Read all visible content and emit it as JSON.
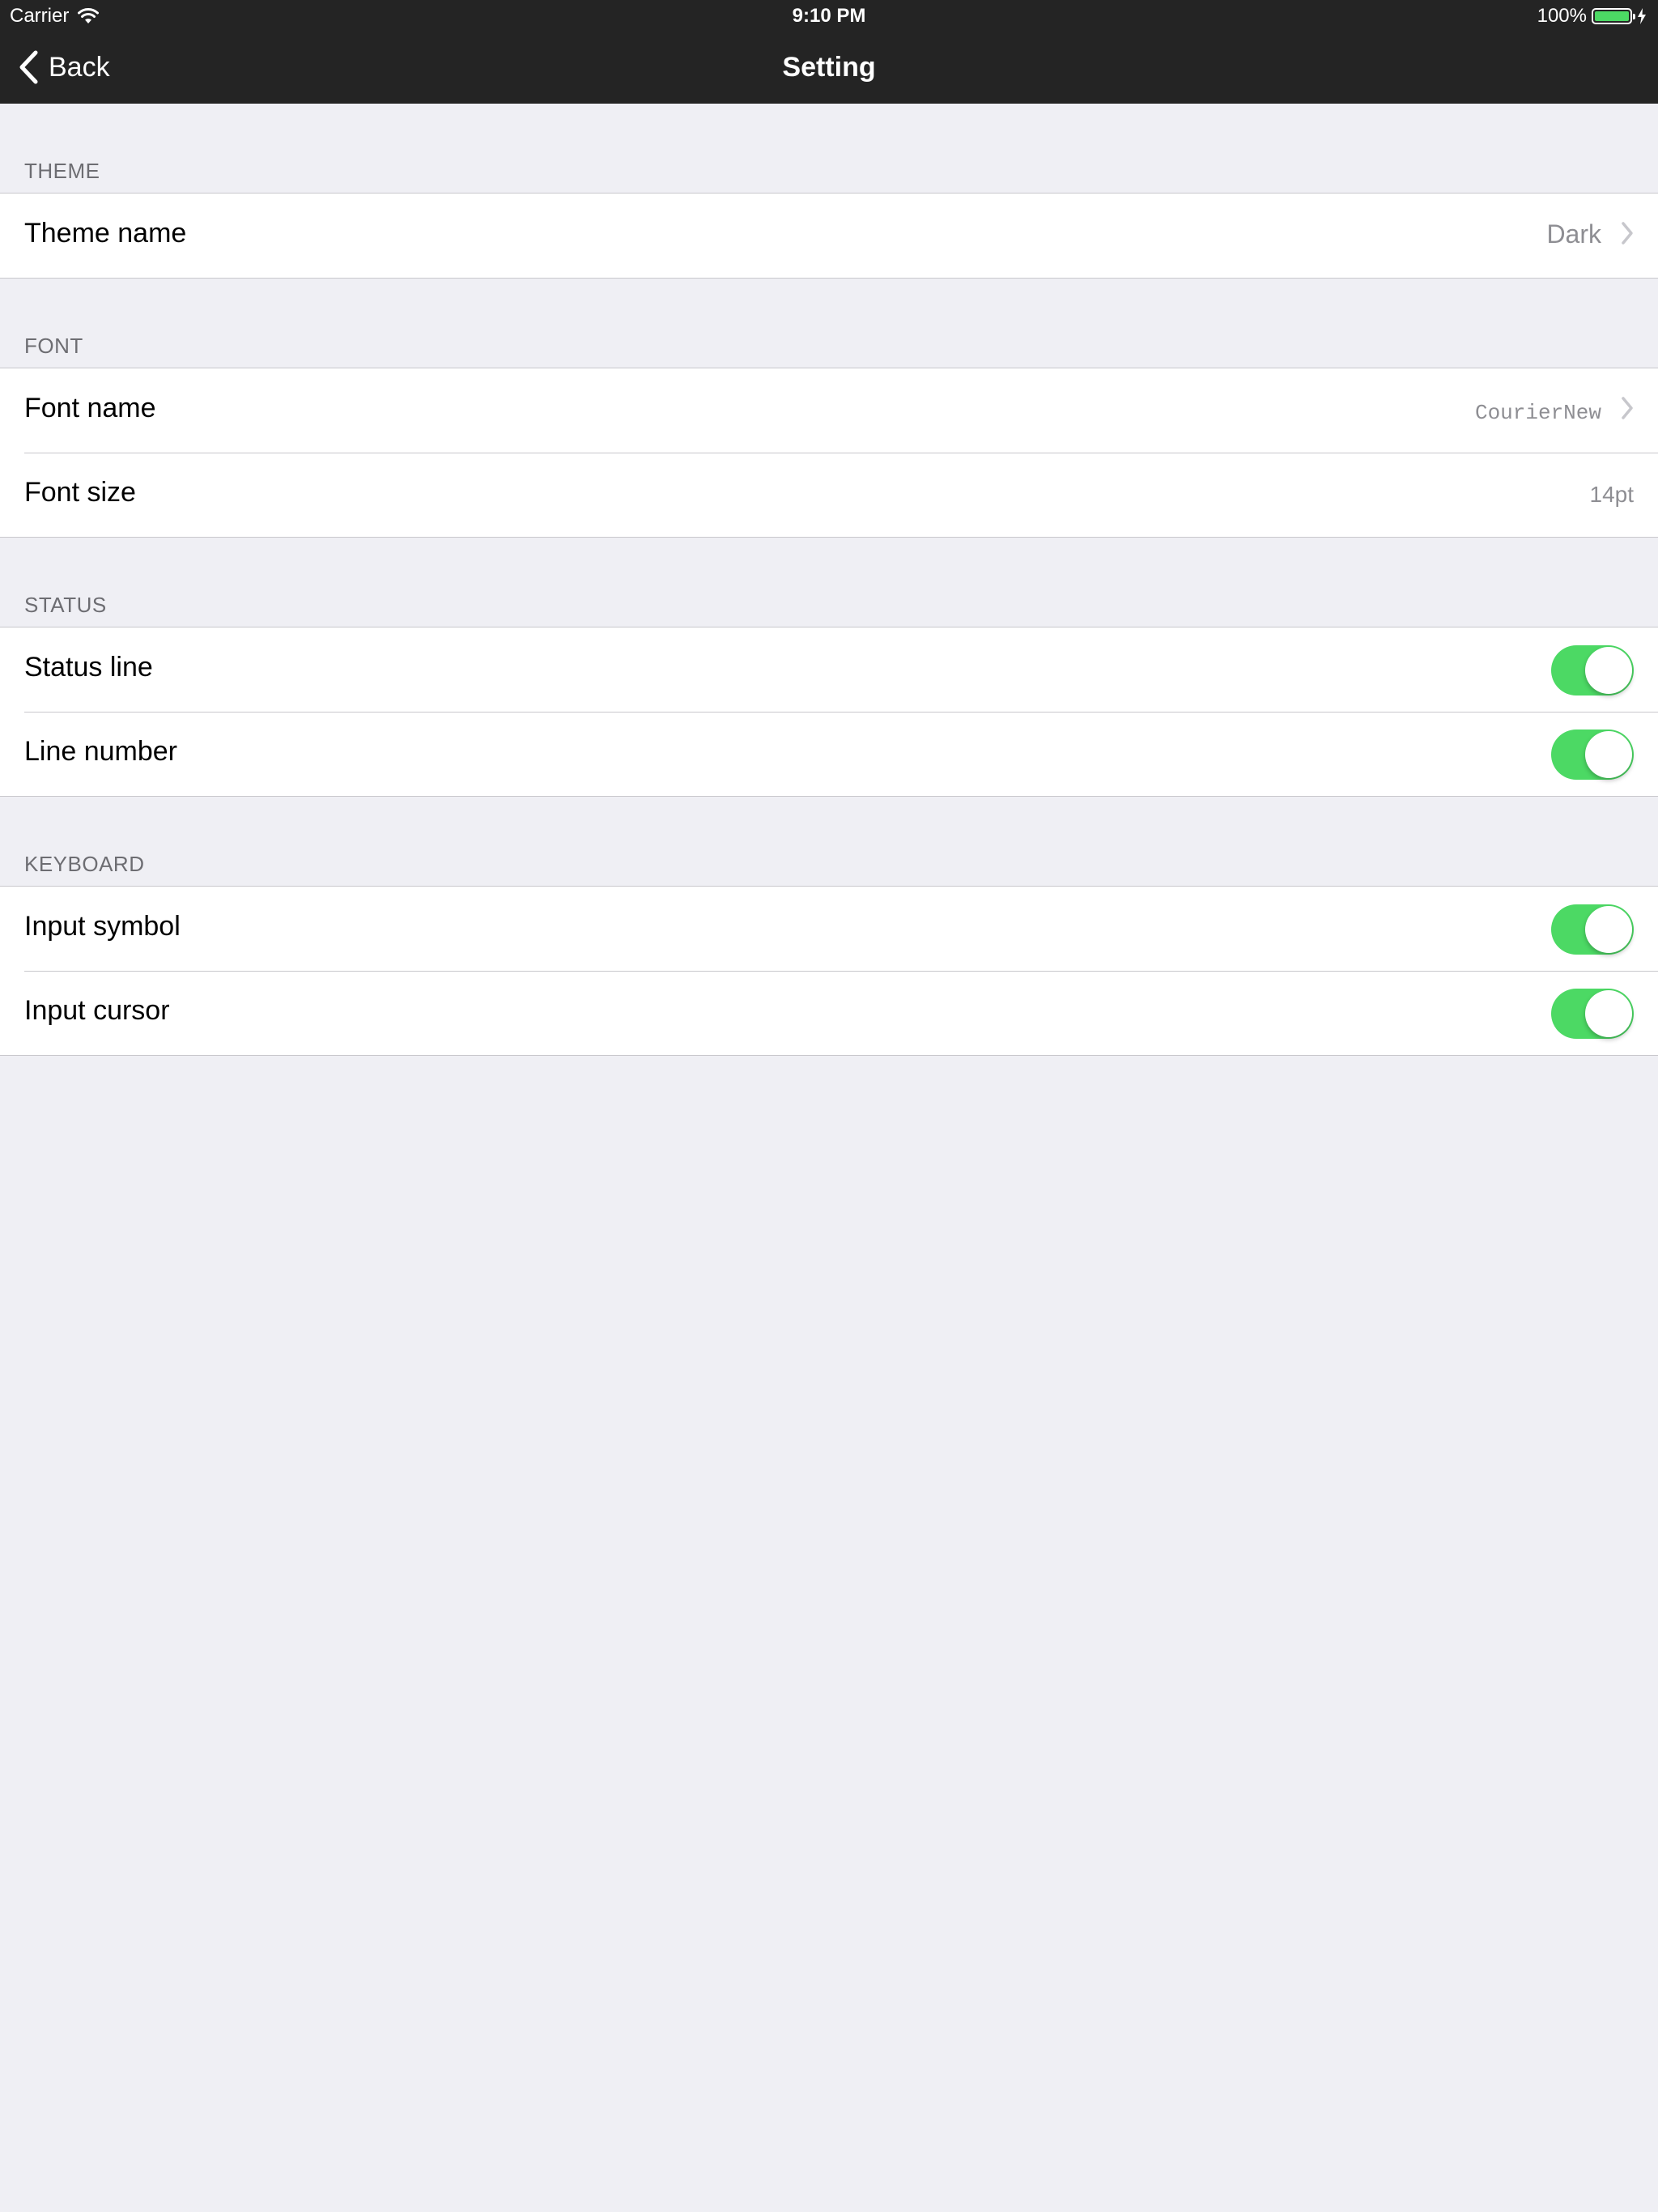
{
  "status_bar": {
    "carrier": "Carrier",
    "time": "9:10 PM",
    "battery": "100%"
  },
  "nav": {
    "back_label": "Back",
    "title": "Setting"
  },
  "sections": {
    "theme": {
      "header": "THEME",
      "theme_name_label": "Theme name",
      "theme_name_value": "Dark"
    },
    "font": {
      "header": "FONT",
      "font_name_label": "Font name",
      "font_name_value": "CourierNew",
      "font_size_label": "Font size",
      "font_size_value": "14pt"
    },
    "status": {
      "header": "STATUS",
      "status_line_label": "Status line",
      "status_line_on": true,
      "line_number_label": "Line number",
      "line_number_on": true
    },
    "keyboard": {
      "header": "KEYBOARD",
      "input_symbol_label": "Input symbol",
      "input_symbol_on": true,
      "input_cursor_label": "Input cursor",
      "input_cursor_on": true
    }
  },
  "colors": {
    "nav_background": "#242424",
    "page_background": "#efeff4",
    "toggle_on": "#4cd964",
    "secondary_text": "#8e8e93",
    "section_header_text": "#6d6d72"
  },
  "icons": {
    "wifi": "wifi-icon",
    "battery": "battery-icon",
    "charging": "bolt-icon",
    "back": "chevron-left-icon",
    "disclosure": "chevron-right-icon"
  }
}
